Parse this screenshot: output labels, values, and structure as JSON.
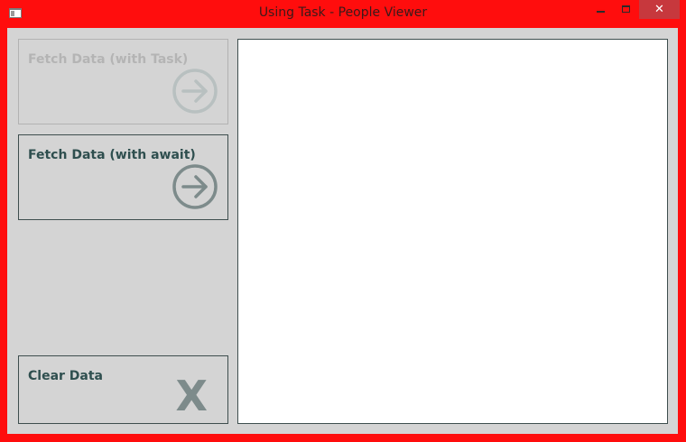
{
  "window": {
    "title": "Using Task - People Viewer",
    "close_glyph": "✕"
  },
  "buttons": {
    "fetch_task": {
      "label": "Fetch Data (with Task)",
      "icon": "arrow-right-circle-icon",
      "enabled": false
    },
    "fetch_await": {
      "label": "Fetch Data (with await)",
      "icon": "arrow-right-circle-icon",
      "enabled": true
    },
    "clear": {
      "label": "Clear Data",
      "icon": "x-icon",
      "glyph": "X",
      "enabled": true
    }
  },
  "people_list": {
    "items": []
  },
  "colors": {
    "window_border": "#ff0d0d",
    "client_background": "#d4d4d4",
    "button_text": "#2f4f4f",
    "icon_enabled": "#7d8b8b",
    "icon_disabled": "#b4b4b4",
    "close_button": "#c7383d"
  }
}
